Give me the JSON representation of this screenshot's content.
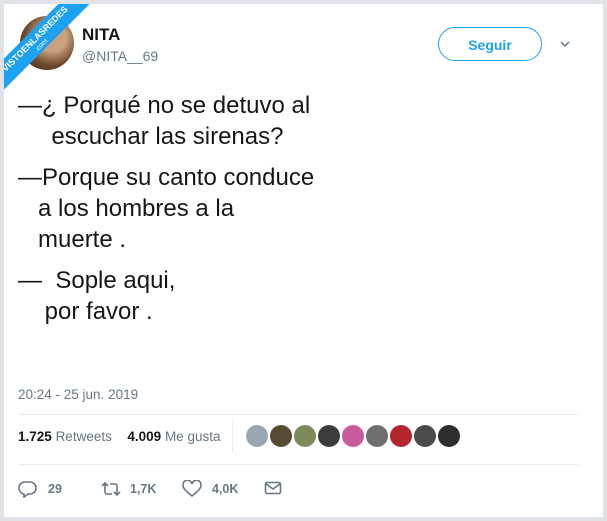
{
  "watermark": {
    "text": "VISTOENLASREDES",
    "subtext": ".com"
  },
  "author": {
    "name": "NITA",
    "handle": "@NITA__69"
  },
  "follow_label": "Seguir",
  "tweet": {
    "lines": [
      "—¿ Porqué no se detuvo al",
      "     escuchar las sirenas?",
      "",
      "—Porque su canto conduce",
      "   a los hombres a la",
      "   muerte .",
      "",
      "—  Sople aqui,",
      "    por favor ."
    ]
  },
  "timestamp": "20:24 - 25 jun. 2019",
  "stats": {
    "retweets_count": "1.725",
    "retweets_label": "Retweets",
    "likes_count": "4.009",
    "likes_label": "Me gusta"
  },
  "liker_colors": [
    "#9aa6b2",
    "#5b4a33",
    "#7d8a5a",
    "#3c3c3c",
    "#c85b9b",
    "#6e6e6e",
    "#b3262c",
    "#4a4a4a",
    "#2d2d2d"
  ],
  "actions": {
    "reply_count": "29",
    "retweet_count": "1,7K",
    "like_count": "4,0K"
  },
  "colors": {
    "accent": "#1da1f2",
    "text": "#14171a",
    "muted": "#657786",
    "border": "#e6ecf0"
  }
}
